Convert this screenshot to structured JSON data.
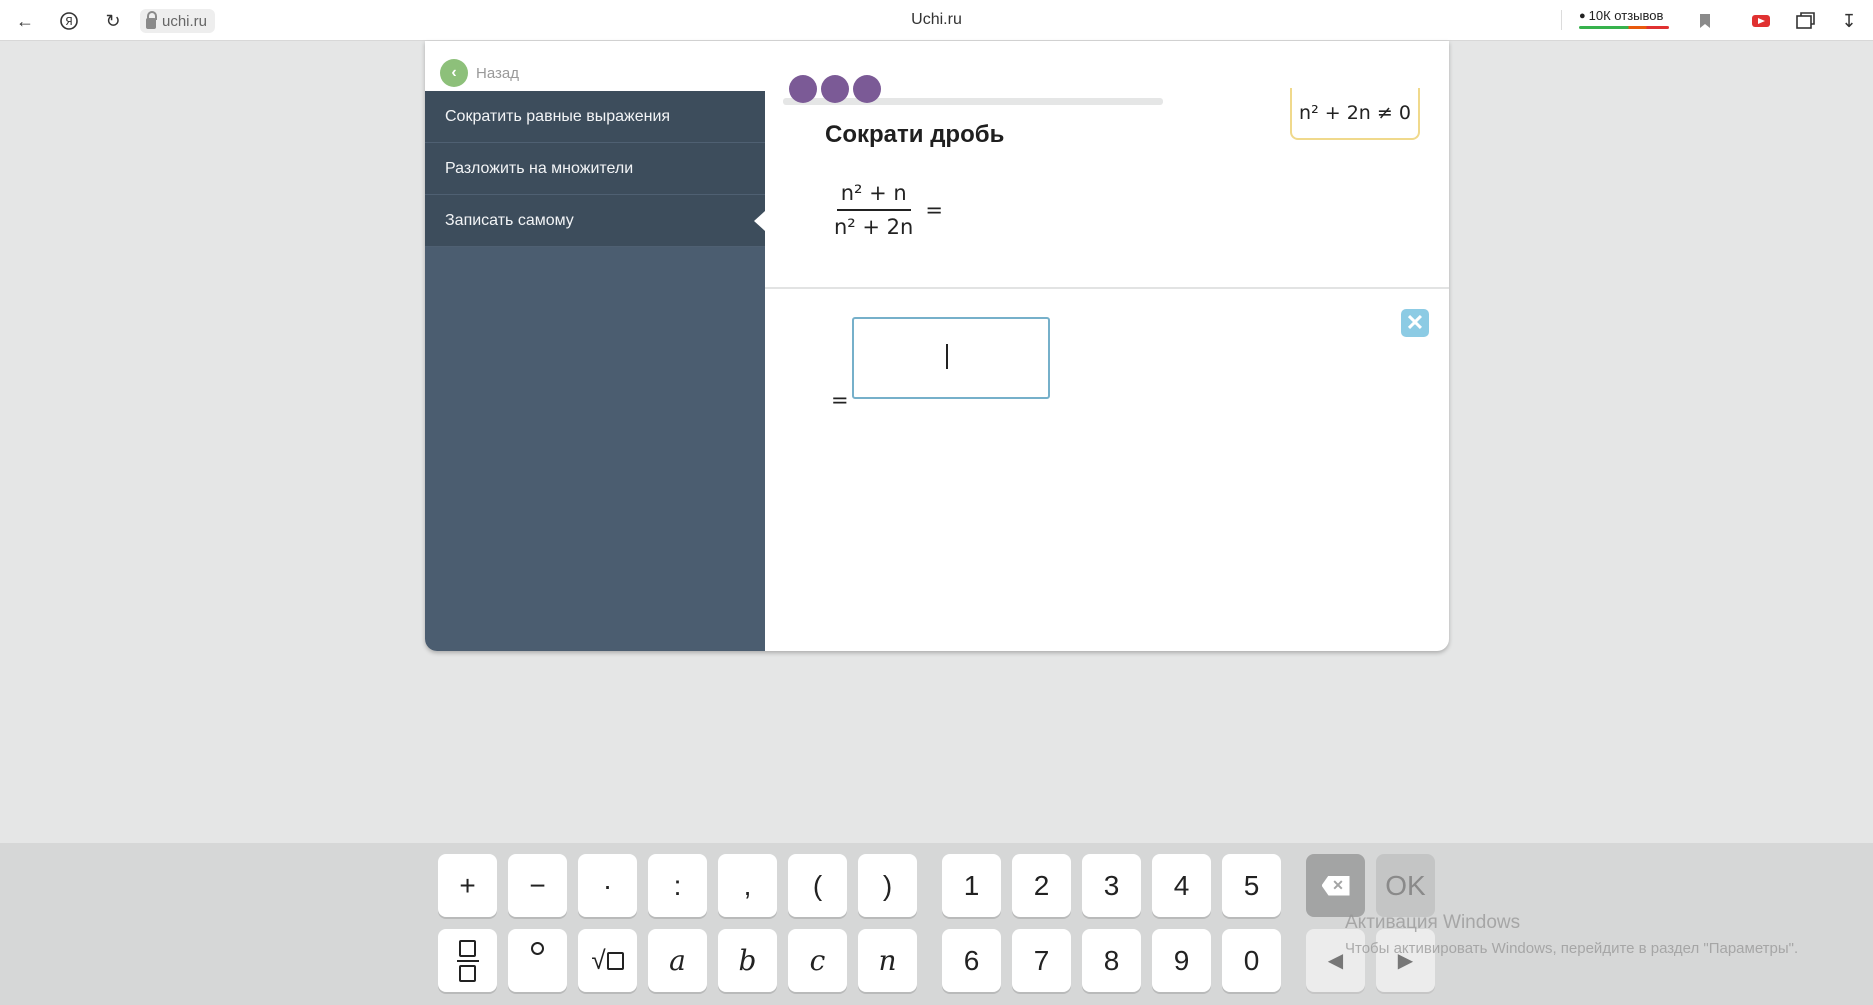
{
  "browser": {
    "url": "uchi.ru",
    "title": "Uchi.ru",
    "reviews_label": "10К отзывов"
  },
  "lesson": {
    "back_label": "Назад",
    "menu": [
      {
        "label": "Сократить равные выражения"
      },
      {
        "label": "Разложить на множители"
      },
      {
        "label": "Записать самому"
      }
    ],
    "title": "Сократи дробь",
    "hint": "n² + 2n ≠ 0",
    "fraction": {
      "numerator": "n² + n",
      "denominator": "n² + 2n",
      "equals": "="
    },
    "answer": {
      "equals": "=",
      "value": ""
    },
    "progress_dots": 3
  },
  "keyboard": {
    "row1_ops": [
      "+",
      "−",
      "·",
      ":",
      ",",
      "(",
      ")"
    ],
    "row1_digits": [
      "1",
      "2",
      "3",
      "4",
      "5"
    ],
    "row2_vars": [
      "a",
      "b",
      "c",
      "n"
    ],
    "row2_digits": [
      "6",
      "7",
      "8",
      "9",
      "0"
    ],
    "ok_label": "OK",
    "left_arrow": "◀",
    "right_arrow": "▶"
  },
  "watermark": {
    "title": "Активация Windows",
    "subtitle": "Чтобы активировать Windows, перейдите в раздел \"Параметры\"."
  },
  "colors": {
    "sidebar": "#4b5d70",
    "progress_dot": "#7b5a96",
    "back_button": "#8dc07a",
    "input_border": "#76b0ca",
    "close_button": "#8ccbe4"
  }
}
